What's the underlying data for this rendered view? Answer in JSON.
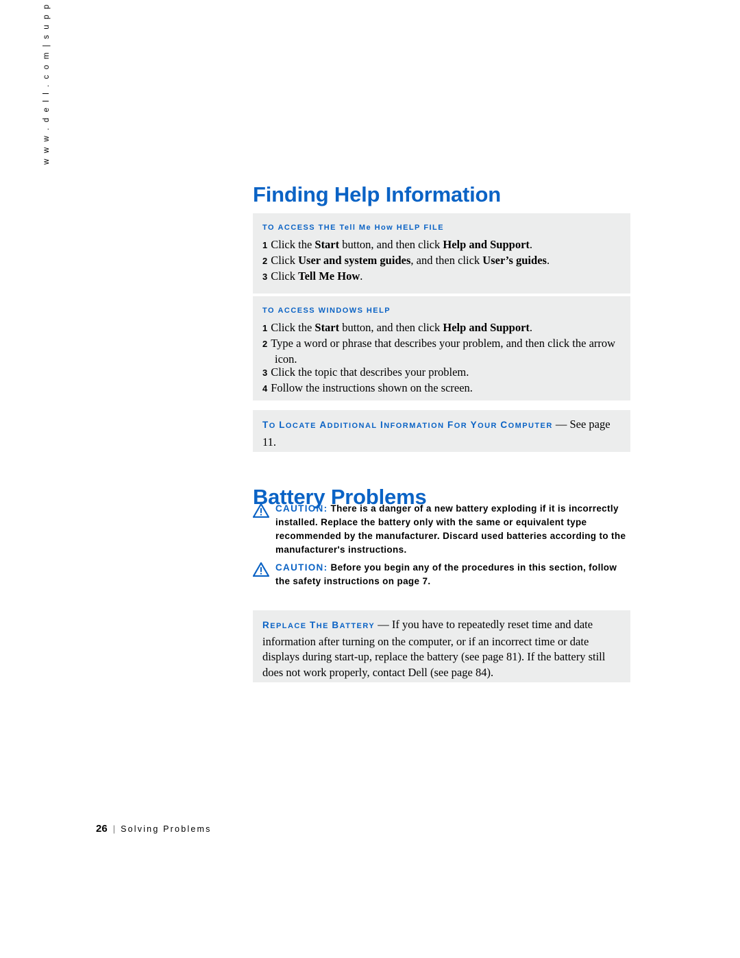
{
  "side_url": {
    "text_right": "s u p p o r t . d e l l . c o m",
    "separator": "|",
    "text_left": "w w w . d e l l . c o m"
  },
  "sections": {
    "finding_help": {
      "title": "Finding Help Information",
      "tellme": {
        "heading_pre": "To ACCESS THE ",
        "heading_title": "Tell Me How",
        "heading_post": " HELP FILE",
        "heading_plain": "TO ACCESS THE Tell Me How HELP FILE",
        "steps": [
          {
            "num": "1",
            "text": "Click the Start button, and then click Help and Support."
          },
          {
            "num": "2",
            "text": "Click User and system guides, and then click User’s guides."
          },
          {
            "num": "3",
            "text": "Click Tell Me How."
          }
        ]
      },
      "windows_help": {
        "heading": "TO ACCESS WINDOWS HELP",
        "steps": [
          {
            "num": "1",
            "text": "Click the Start button, and then click Help and Support."
          },
          {
            "num": "2",
            "text": "Type a word or phrase that describes your problem, and then click the arrow icon."
          },
          {
            "num": "3",
            "text": "Click the topic that describes your problem."
          },
          {
            "num": "4",
            "text": "Follow the instructions shown on the screen."
          }
        ]
      },
      "locate": {
        "heading": "TO LOCATE ADDITIONAL INFORMATION FOR YOUR COMPUTER",
        "dash": "—",
        "body": "See page 11."
      }
    },
    "battery_problems": {
      "title": "Battery Problems",
      "cautions": [
        {
          "label": "CAUTION:",
          "text": "There is a danger of a new battery exploding if it is incorrectly installed. Replace the battery only with the same or equivalent type recommended by the manufacturer. Discard used batteries according to the manufacturer's instructions."
        },
        {
          "label": "CAUTION:",
          "text": "Before you begin any of the procedures in this section, follow the safety instructions on page 7."
        }
      ],
      "replace_battery": {
        "heading": "REPLACE THE BATTERY",
        "dash": "—",
        "body": "If you have to repeatedly reset time and date information after turning on the computer, or if an incorrect time or date displays during start-up, replace the battery (see page 81). If the battery still does not work properly, contact Dell (see page 84)."
      }
    }
  },
  "footer": {
    "page_number": "26",
    "separator": "|",
    "section_name": "Solving Problems"
  },
  "colors": {
    "accent_blue": "#0b63c5",
    "panel_grey": "#eceded"
  }
}
